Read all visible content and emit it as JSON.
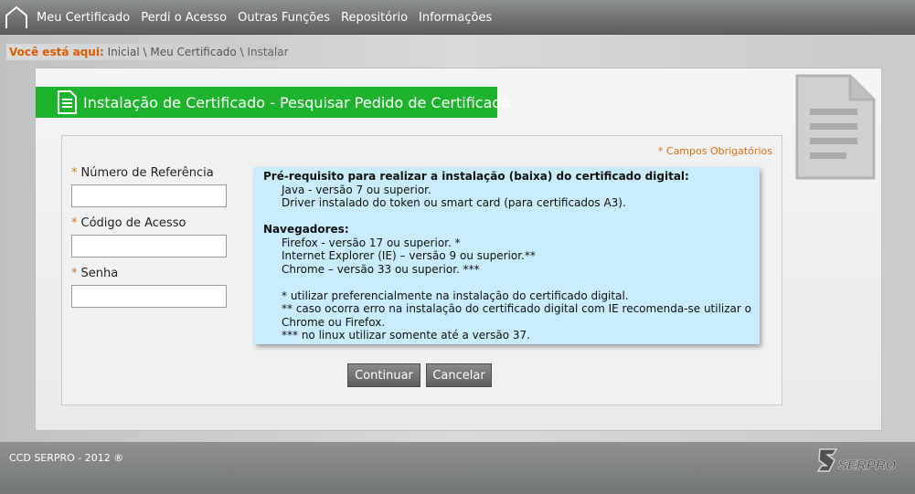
{
  "nav": {
    "items": [
      "Meu Certificado",
      "Perdi o Acesso",
      "Outras Funções",
      "Repositório",
      "Informações"
    ]
  },
  "breadcrumb": {
    "label": "Você está aqui:",
    "items": [
      "Inicial",
      "Meu Certificado",
      "Instalar"
    ],
    "separator": "\\"
  },
  "page": {
    "title": "Instalação de Certificado - Pesquisar Pedido de Certificado"
  },
  "form": {
    "required_note": "* Campos Obrigatórios",
    "required_mark": "*",
    "fields": [
      {
        "label": "Número de Referência",
        "value": ""
      },
      {
        "label": "Código de Acesso",
        "value": ""
      },
      {
        "label": "Senha",
        "value": ""
      }
    ],
    "continue_label": "Continuar",
    "cancel_label": "Cancelar"
  },
  "info": {
    "prereq_title": "Pré-requisito para realizar a instalação (baixa) do certificado digital:",
    "prereq_lines": [
      "Java - versão 7 ou superior.",
      "Driver instalado do token ou smart card (para certificados A3)."
    ],
    "browsers_title": "Navegadores:",
    "browser_lines": [
      "Firefox - versão 17 ou superior. *",
      "Internet Explorer (IE) – versão 9 ou superior.**",
      "Chrome – versão 33 ou superior. ***"
    ],
    "notes": [
      "* utilizar preferencialmente na instalação do certificado digital.",
      "** caso ocorra erro na instalação do certificado digital com IE recomenda-se utilizar o",
      "Chrome ou Firefox.",
      "*** no linux utilizar somente até a versão 37."
    ]
  },
  "footer": {
    "text": "CCD SERPRO - 2012 ®",
    "logo_text": "SERPRO"
  },
  "colors": {
    "accent_green": "#1db32d",
    "required_orange": "#e07010",
    "info_bg": "#c8ecfb"
  }
}
